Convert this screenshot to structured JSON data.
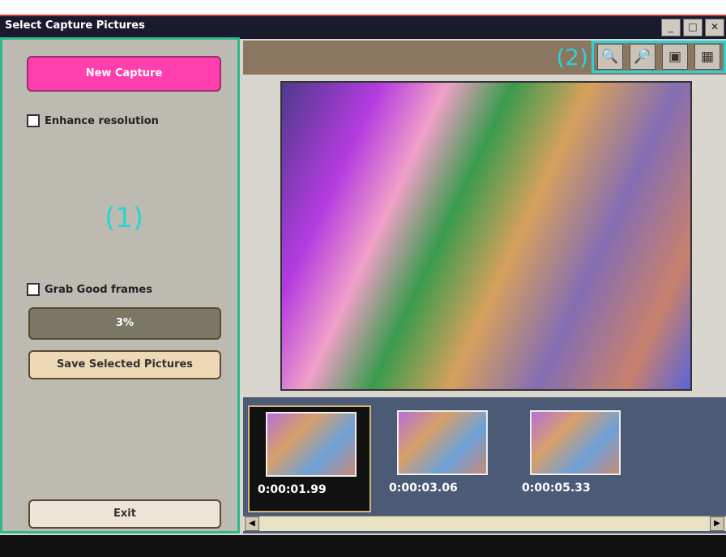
{
  "window": {
    "title": "Select Capture Pictures"
  },
  "left_panel": {
    "new_button": "New Capture",
    "checkbox_resolution": "Enhance resolution",
    "region_label": "(1)",
    "checkbox_frames": "Grab Good frames",
    "percent": "3%",
    "save_button": "Save Selected Pictures",
    "exit_button": "Exit"
  },
  "toolbar": {
    "region_label": "(2)",
    "tools": [
      {
        "icon": "zoom-in-icon",
        "glyph": "🔍"
      },
      {
        "icon": "zoom-out-icon",
        "glyph": "🔎"
      },
      {
        "icon": "fit-icon",
        "glyph": "▣"
      },
      {
        "icon": "actual-size-icon",
        "glyph": "▦"
      }
    ]
  },
  "thumbnails": [
    {
      "time": "0:00:01.99",
      "selected": true
    },
    {
      "time": "0:00:03.06",
      "selected": false
    },
    {
      "time": "0:00:05.33",
      "selected": false
    }
  ]
}
